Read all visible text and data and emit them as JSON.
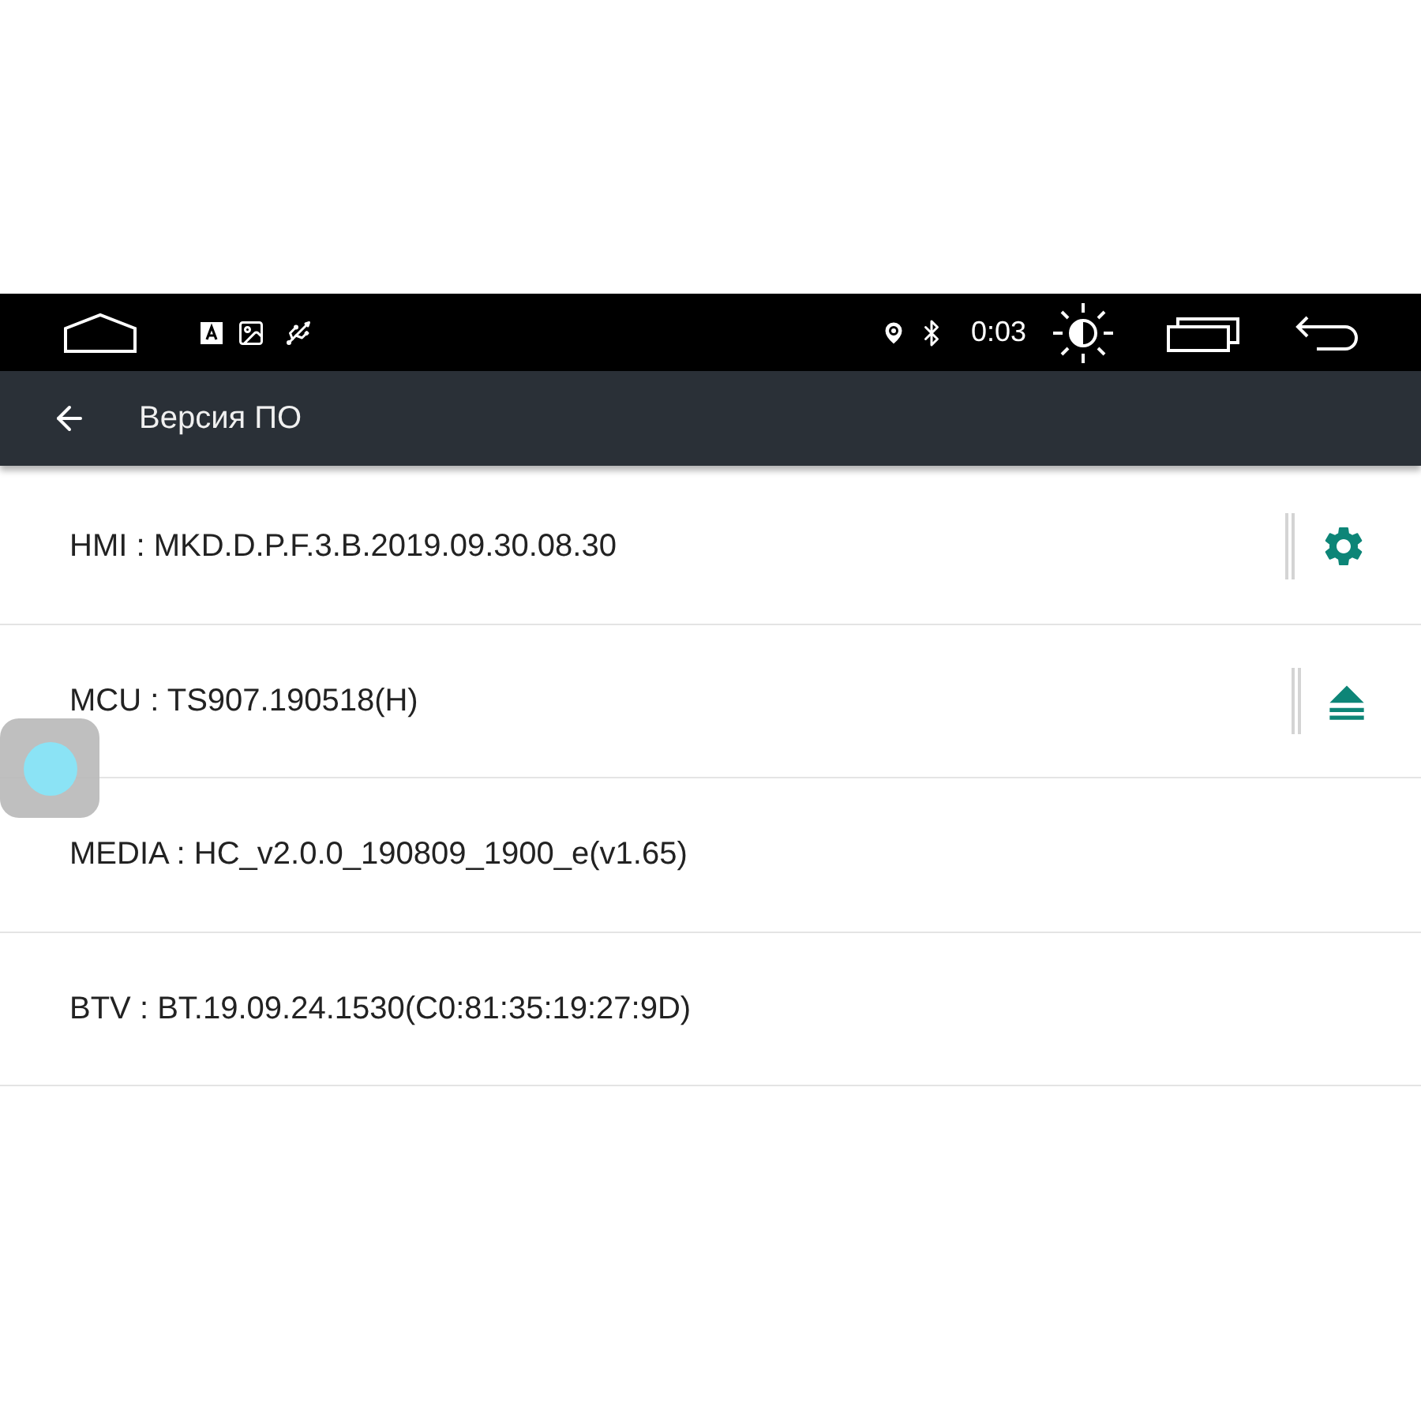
{
  "status_bar": {
    "time": "0:03"
  },
  "app_bar": {
    "title": "Версия ПО"
  },
  "rows": [
    {
      "text": "HMI : MKD.D.P.F.3.B.2019.09.30.08.30",
      "kind": "settings"
    },
    {
      "text": "MCU : TS907.190518(H)",
      "kind": "eject"
    },
    {
      "text": "MEDIA : HC_v2.0.0_190809_1900_e(v1.65)"
    },
    {
      "text": "BTV : BT.19.09.24.1530(C0:81:35:19:27:9D)"
    }
  ]
}
